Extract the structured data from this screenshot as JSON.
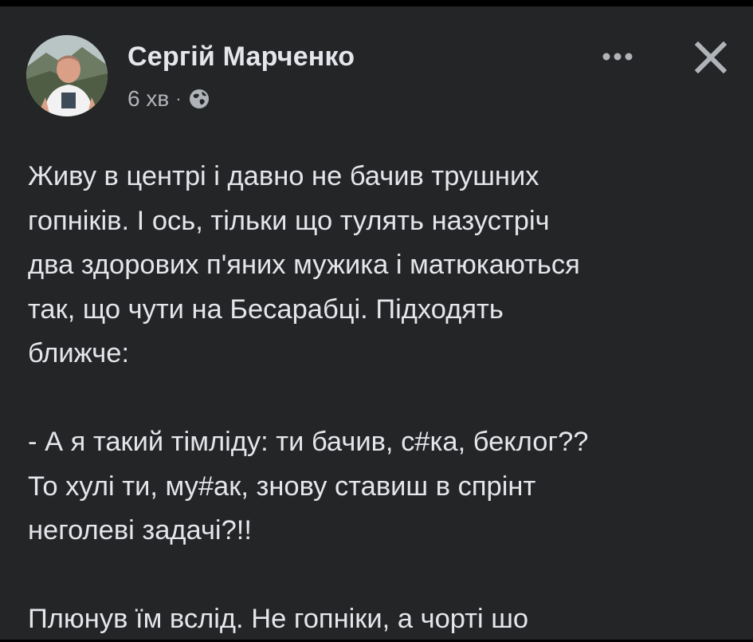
{
  "post": {
    "author": "Сергій Марченко",
    "time": "6 хв",
    "separator": "·",
    "privacy_icon": "globe-icon",
    "paragraphs": [
      [
        "Живу в центрі і давно не бачив трушних",
        "гопніків. І ось, тільки що тулять назустріч",
        "два здорових п'яних мужика і матюкаються",
        "так, що чути на Бесарабці. Підходять",
        "ближче:"
      ],
      [
        "- А я такий тімліду: ти бачив, с#ка, беклог??",
        "То хулі ти, му#ак, знову ставиш в спрінт",
        "неголеві задачі?!!"
      ],
      [
        "Плюнув їм вслід. Не гопніки, а чорті шо"
      ]
    ]
  },
  "header": {
    "more_icon": "more-horizontal-icon",
    "close_icon": "close-icon"
  },
  "colors": {
    "background": "#242526",
    "primary_text": "#e4e6eb",
    "secondary_text": "#b0b3b8"
  }
}
